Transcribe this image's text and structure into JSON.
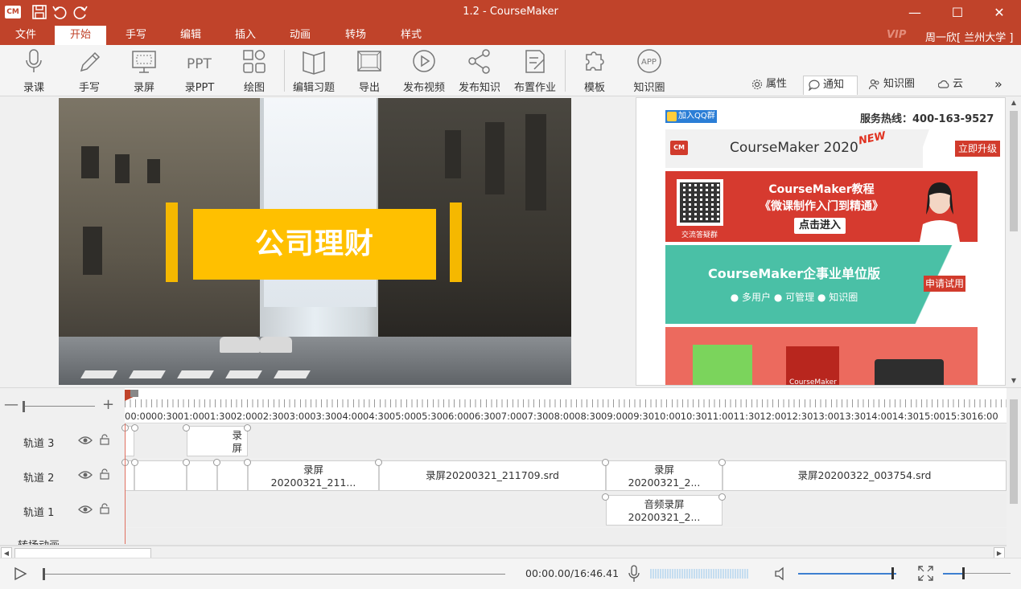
{
  "app": {
    "title": "1.2 - CourseMaker",
    "logo": "CM"
  },
  "quick_access": {
    "icons": [
      "save-icon",
      "undo-icon",
      "redo-icon"
    ]
  },
  "window_controls": {
    "minimize": "—",
    "maximize": "☐",
    "close": "✕"
  },
  "menu": {
    "items": [
      "文件",
      "开始",
      "手写",
      "编辑",
      "插入",
      "动画",
      "转场",
      "样式"
    ],
    "active": "开始",
    "vip": "VIP",
    "user": "周一欣[ 兰州大学 ]"
  },
  "ribbon": {
    "tools": [
      {
        "label": "录课",
        "icon": "microphone-icon"
      },
      {
        "label": "手写",
        "icon": "pen-icon"
      },
      {
        "label": "录屏",
        "icon": "screen-record-icon"
      },
      {
        "label": "录PPT",
        "icon": "ppt-icon"
      },
      {
        "label": "绘图",
        "icon": "shapes-icon"
      },
      {
        "label": "编辑习题",
        "icon": "book-icon"
      },
      {
        "label": "导出",
        "icon": "export-icon"
      },
      {
        "label": "发布视频",
        "icon": "play-circle-icon"
      },
      {
        "label": "发布知识",
        "icon": "share-icon"
      },
      {
        "label": "布置作业",
        "icon": "assignment-icon"
      },
      {
        "label": "模板",
        "icon": "puzzle-icon"
      },
      {
        "label": "知识圈",
        "icon": "app-icon"
      }
    ],
    "panel_tabs": [
      {
        "label": "属性",
        "icon": "gear-icon"
      },
      {
        "label": "通知",
        "icon": "chat-bubble-icon"
      },
      {
        "label": "知识圈",
        "icon": "people-icon"
      },
      {
        "label": "云",
        "icon": "cloud-icon"
      }
    ],
    "active_panel_tab": "通知",
    "more": "»"
  },
  "slide": {
    "title_text": "公司理财"
  },
  "ad_panel": {
    "qq_button": "加入QQ群",
    "hotline": "服务热线：400-163-9527",
    "banner1": {
      "title": "CourseMaker 2020",
      "badge": "NEW",
      "button": "立即升级",
      "logo": "CM"
    },
    "banner2": {
      "line1": "CourseMaker教程",
      "line2": "《微课制作入门到精通》",
      "button": "点击进入",
      "qr_caption": "交流答疑群"
    },
    "banner3": {
      "title": "CourseMaker企事业单位版",
      "features": "● 多用户   ● 可管理   ● 知识圈",
      "button": "申请试用"
    },
    "banner4": {
      "box_label": "CourseMaker"
    }
  },
  "timeline": {
    "zoom_minus": "—",
    "zoom_plus": "+",
    "ruler_labels": [
      "00:00",
      "00:30",
      "01:00",
      "01:30",
      "02:00",
      "02:30",
      "03:00",
      "03:30",
      "04:00",
      "04:30",
      "05:00",
      "05:30",
      "06:00",
      "06:30",
      "07:00",
      "07:30",
      "08:00",
      "08:30",
      "09:00",
      "09:30",
      "10:00",
      "10:30",
      "11:00",
      "11:30",
      "12:00",
      "12:30",
      "13:00",
      "13:30",
      "14:00",
      "14:30",
      "15:00",
      "15:30",
      "16:00"
    ],
    "tracks": [
      {
        "name": "轨道 3",
        "clips": [
          {
            "line1": "录",
            "line2": "屏"
          }
        ]
      },
      {
        "name": "轨道 2",
        "clips": [
          {
            "line1": "录屏",
            "line2": "20200321_211..."
          },
          {
            "line1": "录屏20200321_211709.srd",
            "line2": ""
          },
          {
            "line1": "录屏",
            "line2": "20200321_2..."
          },
          {
            "line1": "录屏20200322_003754.srd",
            "line2": ""
          }
        ]
      },
      {
        "name": "轨道 1",
        "clips": [
          {
            "line1": "音频录屏",
            "line2": "20200321_2..."
          }
        ]
      },
      {
        "name": "转场动画",
        "clips": []
      }
    ]
  },
  "playback": {
    "time": "00:00.00/16:46.41",
    "progress": 0.0,
    "volume": 0.95
  },
  "colors": {
    "brand": "#c0432a",
    "banner_yellow": "#ffc000",
    "accent_blue": "#3d7fd0"
  }
}
